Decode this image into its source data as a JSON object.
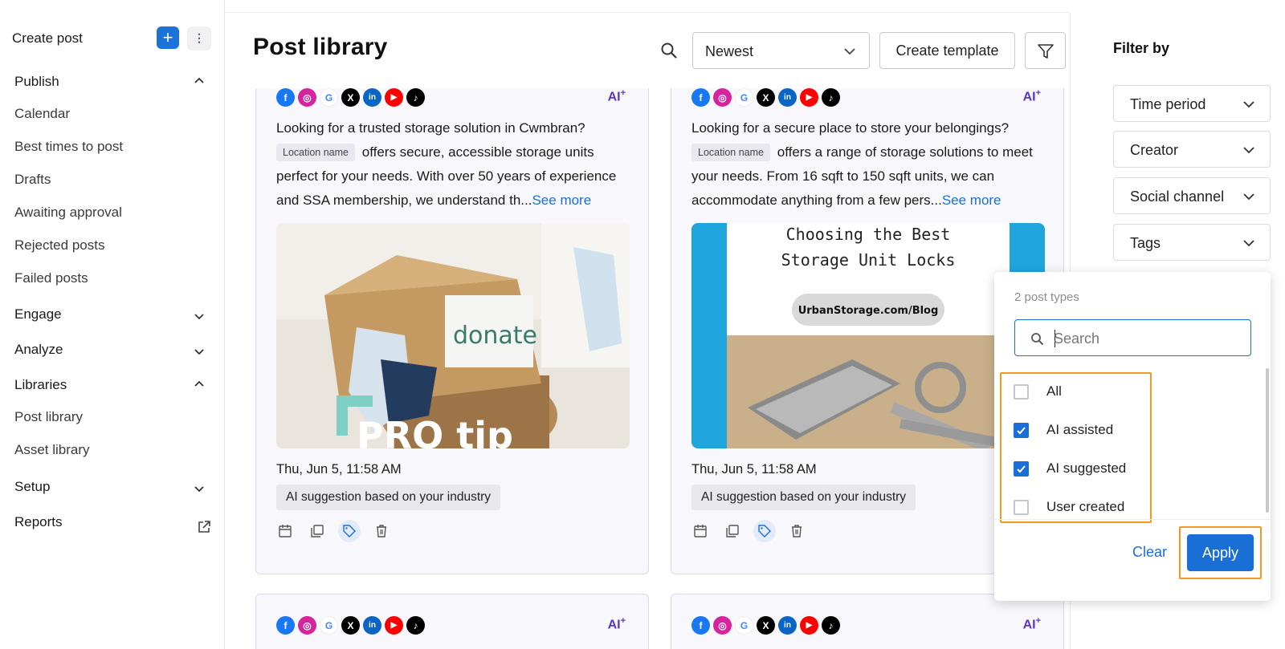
{
  "sidebar": {
    "create_post": "Create post",
    "create_plus": "+",
    "create_more": "⋮",
    "sections": {
      "publish": "Publish",
      "engage": "Engage",
      "analyze": "Analyze",
      "libraries": "Libraries",
      "setup": "Setup",
      "reports": "Reports"
    },
    "publish_items": [
      "Calendar",
      "Best times to post",
      "Drafts",
      "Awaiting approval",
      "Rejected posts",
      "Failed posts"
    ],
    "library_items": [
      "Post library",
      "Asset library"
    ]
  },
  "header": {
    "title": "Post library",
    "sort_value": "Newest",
    "create_template": "Create template"
  },
  "cards": [
    {
      "ai_badge": "AI",
      "text_1": "Looking for a trusted storage solution in Cwmbran?",
      "location_chip": "Location name",
      "text_2": "offers secure, accessible storage units perfect for your needs. With over 50 years of experience and SSA membership, we understand th...",
      "see_more": "See more",
      "image_text": "donate",
      "image_caption": "PRO tip",
      "date": "Thu, Jun 5, 11:58 AM",
      "chip": "AI suggestion based on your industry"
    },
    {
      "ai_badge": "AI",
      "text_1": "Looking for a secure place to store your belongings?",
      "location_chip": "Location name",
      "text_2": "offers a range of storage solutions to meet your needs. From 16 sqft to 150 sqft units, we can accommodate anything from a few pers...",
      "see_more": "See more",
      "image_title_1": "Choosing the Best",
      "image_title_2": "Storage Unit Locks",
      "image_url": "UrbanStorage.com/Blog",
      "date": "Thu, Jun 5, 11:58 AM",
      "chip": "AI suggestion based on your industry"
    }
  ],
  "bottom_cards": [
    {
      "ai_badge": "AI"
    },
    {
      "ai_badge": "AI"
    }
  ],
  "filter_panel": {
    "title": "Filter by",
    "selects": [
      "Time period",
      "Creator",
      "Social channel",
      "Tags"
    ]
  },
  "popover": {
    "count": "2 post types",
    "search_placeholder": "Search",
    "options": [
      {
        "label": "All",
        "checked": false
      },
      {
        "label": "AI assisted",
        "checked": true
      },
      {
        "label": "AI suggested",
        "checked": true
      },
      {
        "label": "User created",
        "checked": false
      }
    ],
    "clear": "Clear",
    "apply": "Apply"
  },
  "colors": {
    "accent": "#1a6fd6",
    "highlight": "#f29a1f",
    "ai_purple": "#5b37c7",
    "card_bg": "#f8f7fc"
  }
}
